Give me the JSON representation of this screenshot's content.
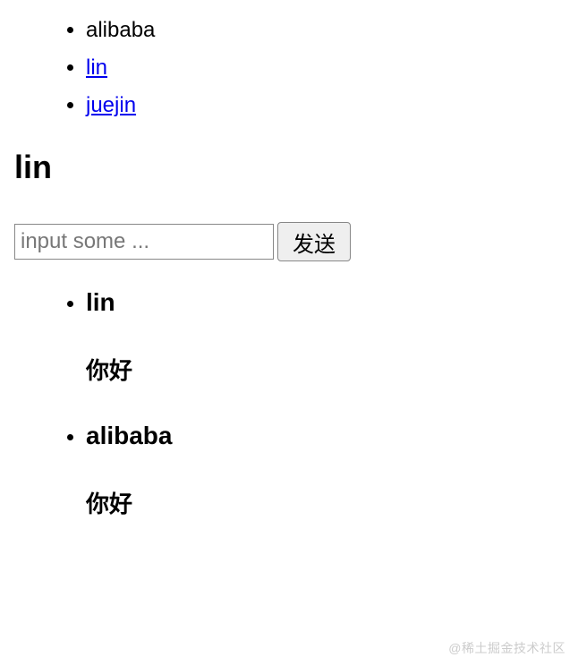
{
  "nav": {
    "items": [
      {
        "label": "alibaba",
        "is_link": false
      },
      {
        "label": "lin",
        "is_link": true
      },
      {
        "label": "juejin",
        "is_link": true
      }
    ]
  },
  "heading": "lin",
  "form": {
    "placeholder": "input some ...",
    "value": "",
    "send_label": "发送"
  },
  "messages": [
    {
      "sender": "lin",
      "content": "你好"
    },
    {
      "sender": "alibaba",
      "content": "你好"
    }
  ],
  "watermark": "@稀土掘金技术社区"
}
